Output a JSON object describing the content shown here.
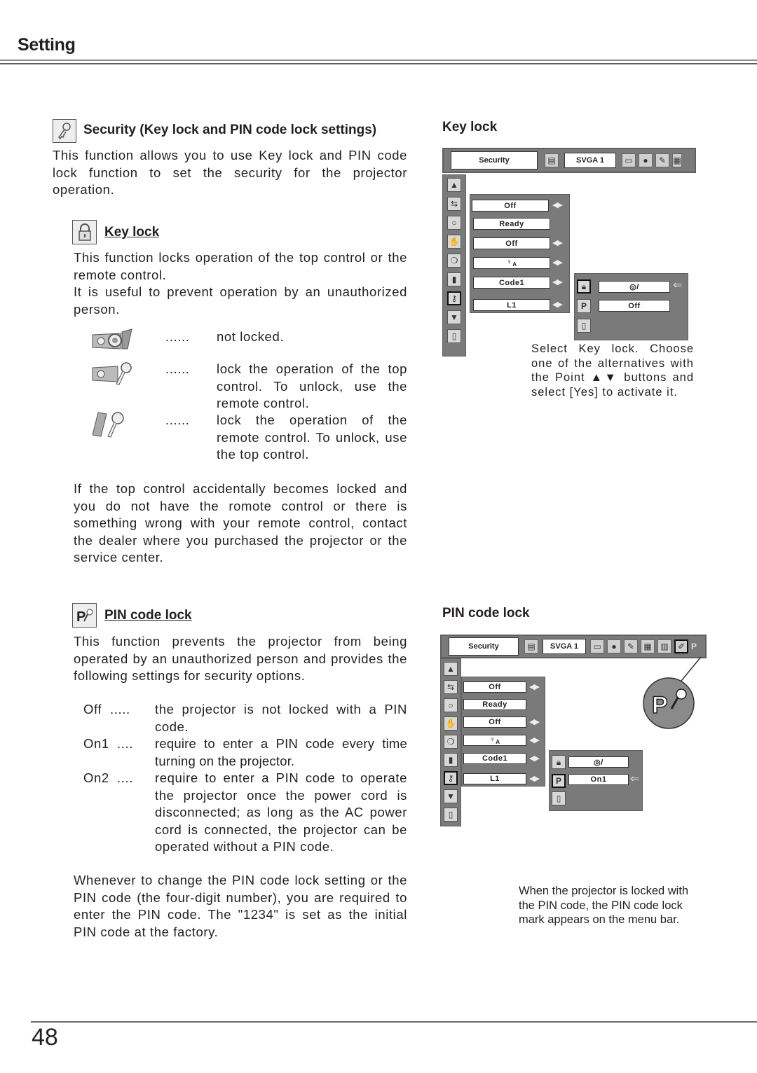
{
  "header": {
    "title": "Setting"
  },
  "security": {
    "icon": "key-icon",
    "heading": "Security (Key lock and PIN code lock settings)",
    "intro": "This function allows you to use Key lock and PIN code lock function to set the security for the projector operation."
  },
  "key_lock": {
    "icon": "padlock-icon",
    "heading": "Key lock",
    "para1": "This function locks operation of the top control or the remote control.",
    "para2": "It is useful to prevent operation by an unauthorized person.",
    "options": [
      {
        "icon": "projector-not-locked-icon",
        "dots": "......",
        "text": "not locked."
      },
      {
        "icon": "projector-key-icon",
        "dots": "......",
        "text": "lock the operation of the top control. To unlock, use the remote control."
      },
      {
        "icon": "remote-key-icon",
        "dots": "......",
        "text": "lock the operation of the remote control. To unlock, use the top control."
      }
    ],
    "note": "If the top control accidentally becomes locked and you do not have the romote control or there is something wrong with your remote control, contact the dealer where you purchased the projector or the service center."
  },
  "pin_lock": {
    "icon": "pin-key-icon",
    "heading": "PIN code lock",
    "para1": "This function prevents the projector from being operated by an unauthorized person and provides the following settings for security options.",
    "options": [
      {
        "label": "Off",
        "dots": ".....",
        "text": "the projector is not locked with a PIN code."
      },
      {
        "label": "On1",
        "dots": "....",
        "text": "require to enter a PIN code every time turning on the projector."
      },
      {
        "label": "On2",
        "dots": "....",
        "text": "require to enter a PIN code to operate the projector once the power cord is disconnected;  as long as the AC power cord is connected, the projector can be operated without a PIN code."
      }
    ],
    "note": "Whenever to change the PIN code lock setting or the PIN code (the four-digit number), you are required to enter the PIN code.  The \"1234\" is set as the initial PIN code at the factory."
  },
  "fig_key_lock": {
    "heading": "Key lock",
    "menubar": {
      "menu_name": "Security",
      "source": "SVGA 1"
    },
    "items": [
      "Off",
      "Ready",
      "Off",
      "",
      "Code1",
      "L1"
    ],
    "sub_items": [
      "",
      "Off"
    ],
    "caption": "Select Key lock.  Choose one of the alternatives with the Point ▲▼ buttons and select [Yes] to activate it."
  },
  "fig_pin_lock": {
    "heading": "PIN code lock",
    "menubar": {
      "menu_name": "Security",
      "source": "SVGA 1",
      "lock_mark": "P"
    },
    "items": [
      "Off",
      "Ready",
      "Off",
      "",
      "Code1",
      "L1"
    ],
    "sub_items": [
      "",
      "On1"
    ],
    "callout": "P",
    "caption": "When the projector is locked with the PIN code, the PIN code lock mark appears on the menu bar."
  },
  "footer": {
    "page_number": "48"
  }
}
